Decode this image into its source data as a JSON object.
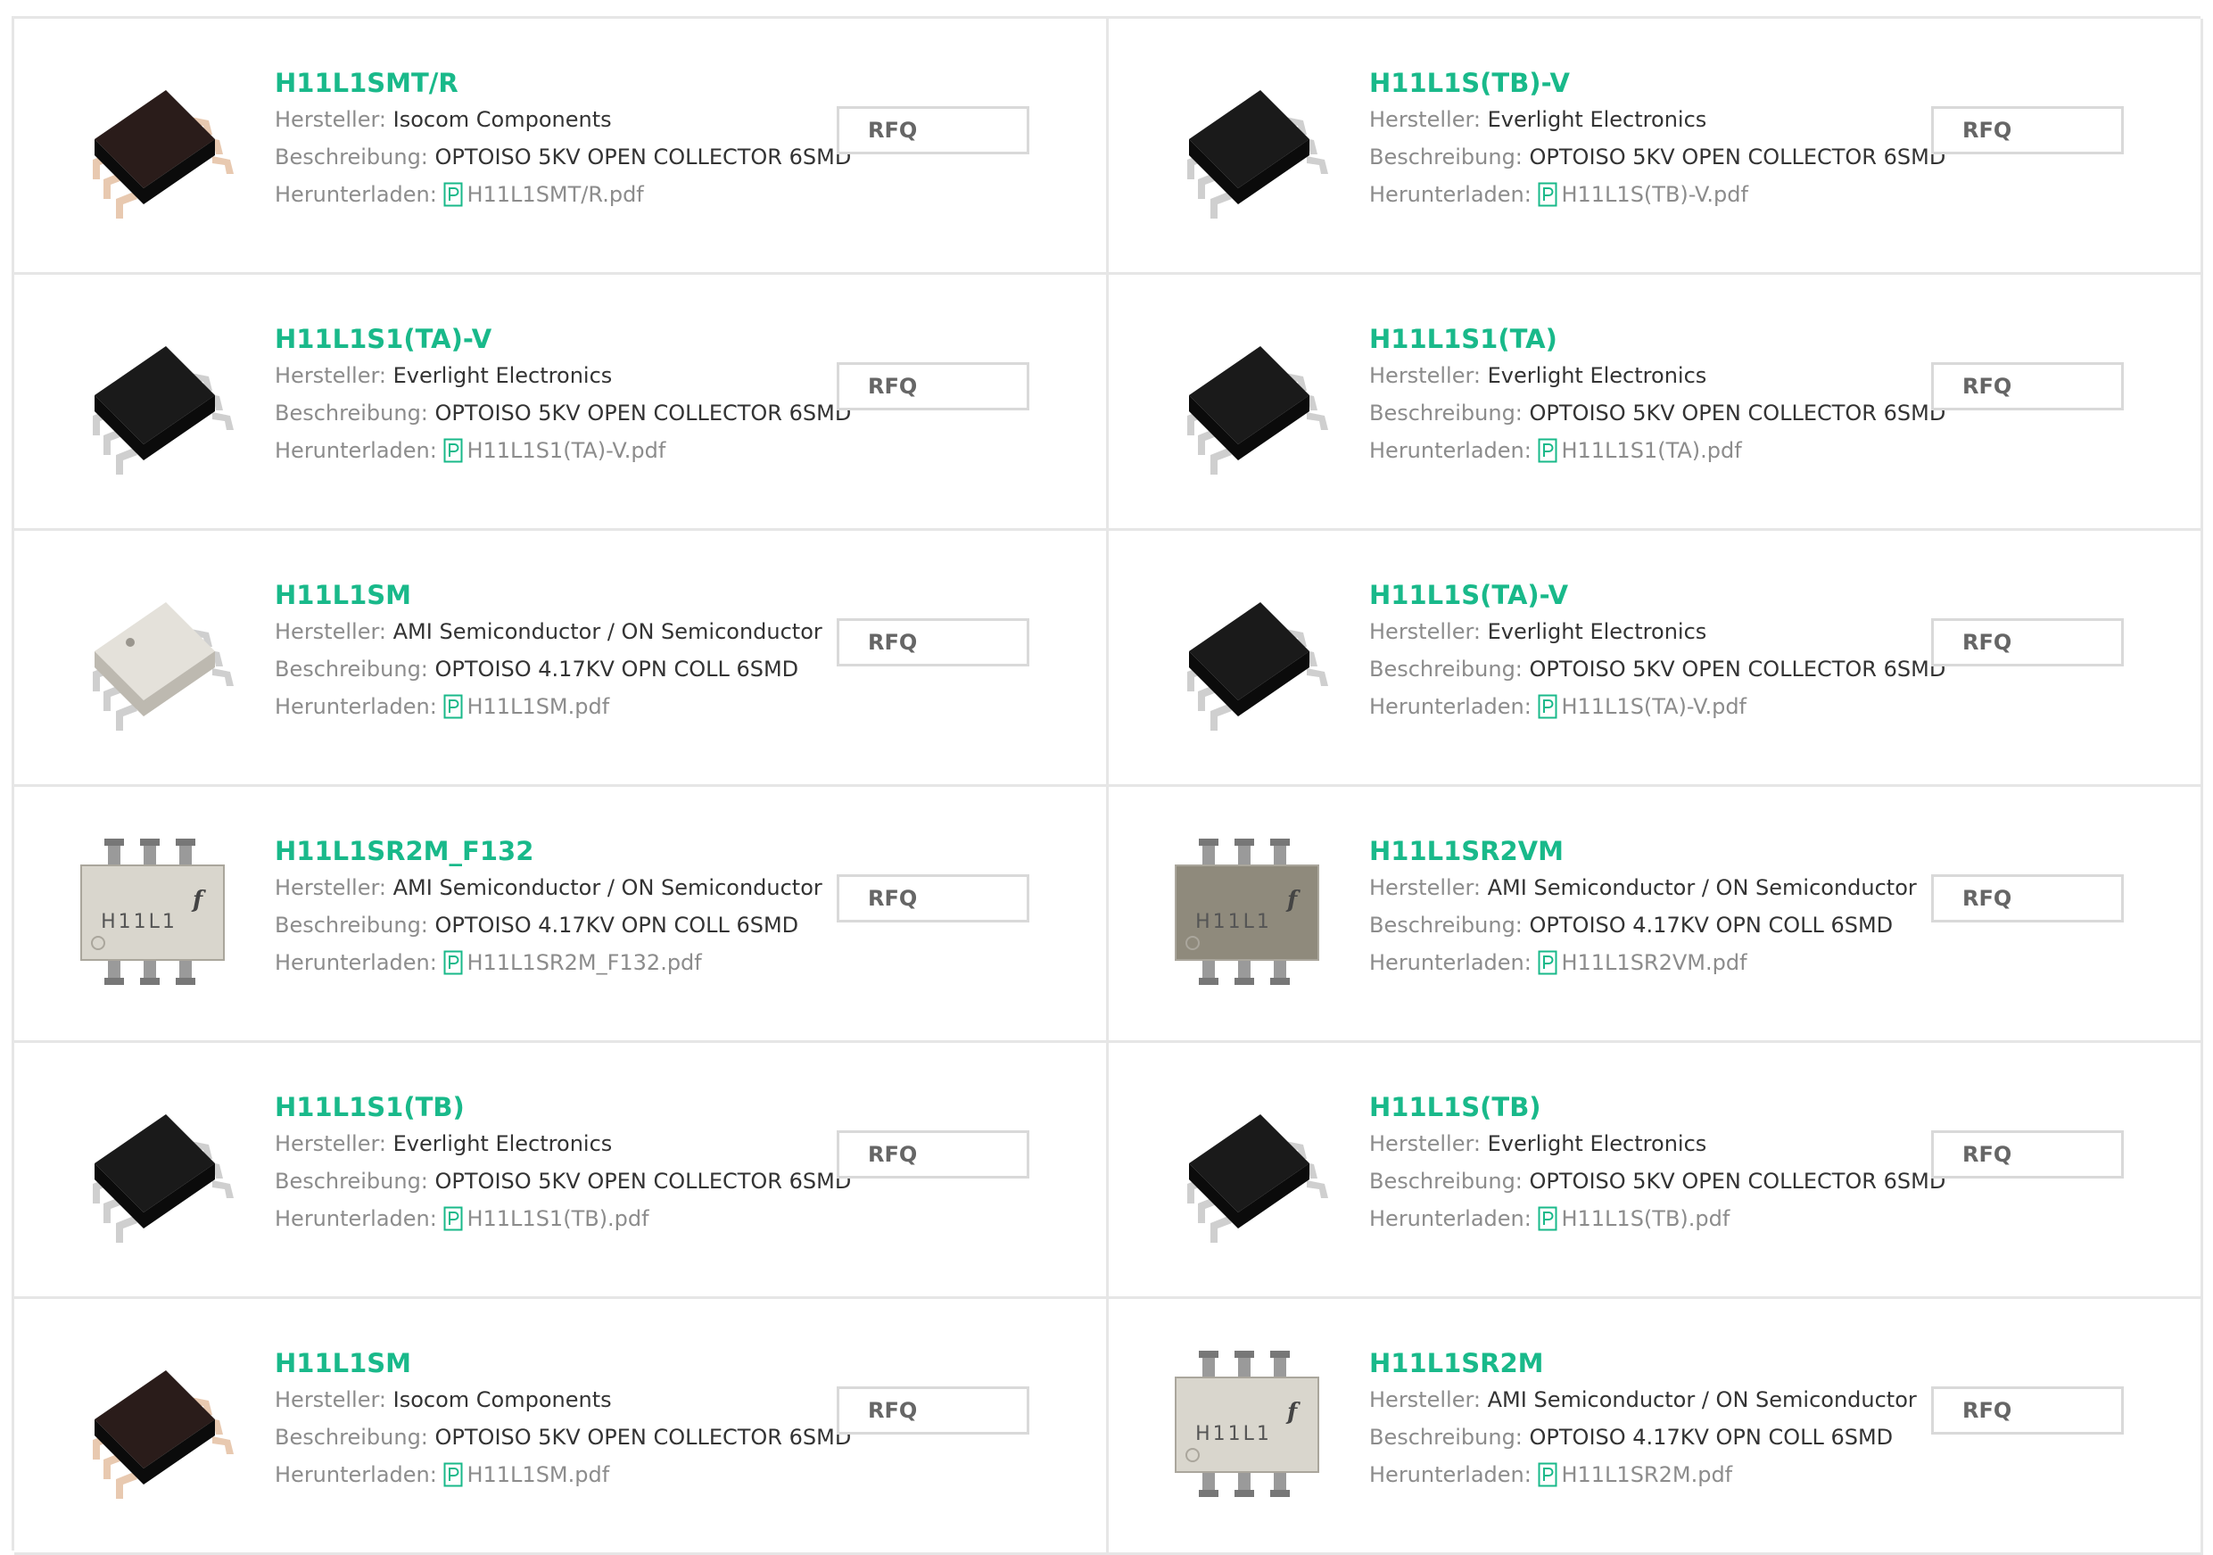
{
  "labels": {
    "manufacturer": "Hersteller:",
    "description": "Beschreibung:",
    "download": "Herunterladen:"
  },
  "colors": {
    "accent": "#19b98a",
    "label": "#8c8c8c",
    "value": "#333333",
    "border": "#e6e6e6"
  },
  "icons": {
    "pdf": "pdf-icon"
  },
  "products": [
    {
      "part": "H11L1SMT/R",
      "manufacturer": "Isocom Components",
      "description": "OPTOISO 5KV OPEN COLLECTOR 6SMD",
      "file": "H11L1SMT/R.pdf",
      "rfq": "RFQ",
      "image": "chip-smd-isocom-icon"
    },
    {
      "part": "H11L1S(TB)-V",
      "manufacturer": "Everlight Electronics",
      "description": "OPTOISO 5KV OPEN COLLECTOR 6SMD",
      "file": "H11L1S(TB)-V.pdf",
      "rfq": "RFQ",
      "image": "chip-smd-black-icon"
    },
    {
      "part": "H11L1S1(TA)-V",
      "manufacturer": "Everlight Electronics",
      "description": "OPTOISO 5KV OPEN COLLECTOR 6SMD",
      "file": "H11L1S1(TA)-V.pdf",
      "rfq": "RFQ",
      "image": "chip-smd-black-icon"
    },
    {
      "part": "H11L1S1(TA)",
      "manufacturer": "Everlight Electronics",
      "description": "OPTOISO 5KV OPEN COLLECTOR 6SMD",
      "file": "H11L1S1(TA).pdf",
      "rfq": "RFQ",
      "image": "chip-smd-black-icon"
    },
    {
      "part": "H11L1SM",
      "manufacturer": "AMI Semiconductor / ON Semiconductor",
      "description": "OPTOISO 4.17KV OPN COLL 6SMD",
      "file": "H11L1SM.pdf",
      "rfq": "RFQ",
      "image": "chip-smd-white-icon"
    },
    {
      "part": "H11L1S(TA)-V",
      "manufacturer": "Everlight Electronics",
      "description": "OPTOISO 5KV OPEN COLLECTOR 6SMD",
      "file": "H11L1S(TA)-V.pdf",
      "rfq": "RFQ",
      "image": "chip-smd-black-icon"
    },
    {
      "part": "H11L1SR2M_F132",
      "manufacturer": "AMI Semiconductor / ON Semiconductor",
      "description": "OPTOISO 4.17KV OPN COLL 6SMD",
      "file": "H11L1SR2M_F132.pdf",
      "rfq": "RFQ",
      "image": "chip-top-h11l1-light-icon",
      "marking": "H11L1"
    },
    {
      "part": "H11L1SR2VM",
      "manufacturer": "AMI Semiconductor / ON Semiconductor",
      "description": "OPTOISO 4.17KV OPN COLL 6SMD",
      "file": "H11L1SR2VM.pdf",
      "rfq": "RFQ",
      "image": "chip-top-h11l1-dark-icon",
      "marking": "H11L1"
    },
    {
      "part": "H11L1S1(TB)",
      "manufacturer": "Everlight Electronics",
      "description": "OPTOISO 5KV OPEN COLLECTOR 6SMD",
      "file": "H11L1S1(TB).pdf",
      "rfq": "RFQ",
      "image": "chip-smd-black-icon"
    },
    {
      "part": "H11L1S(TB)",
      "manufacturer": "Everlight Electronics",
      "description": "OPTOISO 5KV OPEN COLLECTOR 6SMD",
      "file": "H11L1S(TB).pdf",
      "rfq": "RFQ",
      "image": "chip-smd-black-icon"
    },
    {
      "part": "H11L1SM",
      "manufacturer": "Isocom Components",
      "description": "OPTOISO 5KV OPEN COLLECTOR 6SMD",
      "file": "H11L1SM.pdf",
      "rfq": "RFQ",
      "image": "chip-smd-isocom-icon"
    },
    {
      "part": "H11L1SR2M",
      "manufacturer": "AMI Semiconductor / ON Semiconductor",
      "description": "OPTOISO 4.17KV OPN COLL 6SMD",
      "file": "H11L1SR2M.pdf",
      "rfq": "RFQ",
      "image": "chip-top-h11l1-light-icon",
      "marking": "H11L1"
    }
  ]
}
